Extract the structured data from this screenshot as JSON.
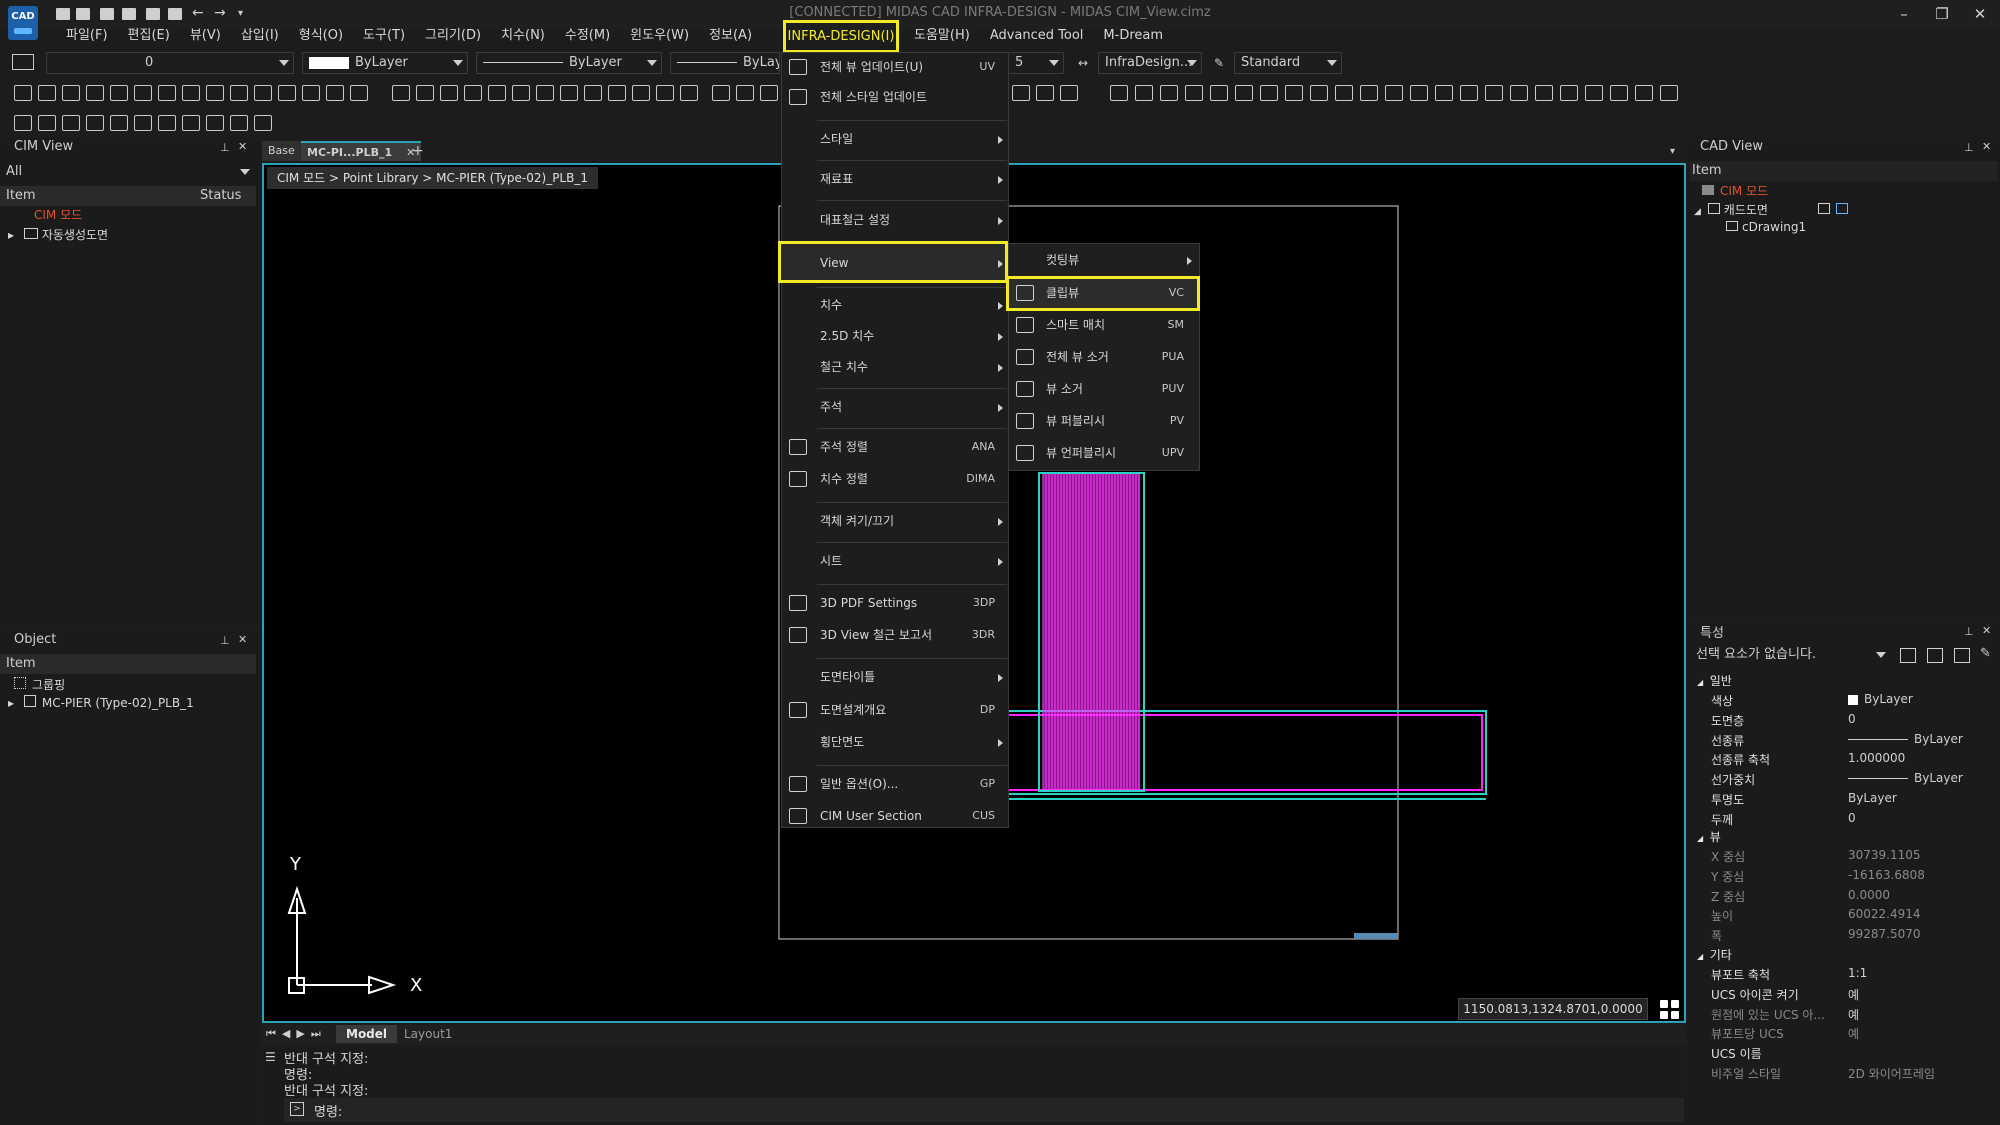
{
  "app": {
    "title": "[CONNECTED] MIDAS CAD INFRA-DESIGN - MIDAS CIM_View.cimz",
    "logo_text": "CAD",
    "accent": "#f2ea25",
    "viewport_border": "#2aa3b8"
  },
  "menubar": [
    "파일(F)",
    "편집(E)",
    "뷰(V)",
    "삽입(I)",
    "형식(O)",
    "도구(T)",
    "그리기(D)",
    "치수(N)",
    "수정(M)",
    "윈도우(W)",
    "정보(A)"
  ],
  "menubar_active": "INFRA-DESIGN(I)",
  "menubar_after": [
    "도움말(H)",
    "Advanced Tool",
    "M-Dream"
  ],
  "toolbar": {
    "layer_value": "0",
    "color_value": "ByLayer",
    "linetype_value": "ByLayer",
    "lineweight_value": "ByLay",
    "scale_value": "5",
    "dimstyle_value": "InfraDesign...",
    "textstyle_value": "Standard"
  },
  "cim_view": {
    "title": "CIM View",
    "filter": "All",
    "col_item": "Item",
    "col_status": "Status",
    "items": [
      "CIM 모드",
      "자동생성도면"
    ]
  },
  "object_panel": {
    "title": "Object",
    "col_item": "Item",
    "items": [
      "그룹핑",
      "MC-PIER (Type-02)_PLB_1"
    ]
  },
  "doc_tabs": [
    "Base",
    "MC-PI...PLB_1"
  ],
  "breadcrumb": "CIM 모드 > Point Library > MC-PIER (Type-02)_PLB_1",
  "main_menu": [
    {
      "label": "전체 뷰 업데이트(U)",
      "key": "UV"
    },
    {
      "label": "전체 스타일 업데이트",
      "key": ""
    },
    {
      "label": "스타일",
      "key": ""
    },
    {
      "label": "재료표",
      "key": ""
    },
    {
      "label": "대표철근 설정",
      "key": ""
    },
    {
      "label": "View",
      "key": ""
    },
    {
      "label": "치수",
      "key": ""
    },
    {
      "label": "2.5D 치수",
      "key": ""
    },
    {
      "label": "철근 치수",
      "key": ""
    },
    {
      "label": "주석",
      "key": ""
    },
    {
      "label": "주석 정렬",
      "key": "ANA"
    },
    {
      "label": "치수 정렬",
      "key": "DIMA"
    },
    {
      "label": "객체 켜기/끄기",
      "key": ""
    },
    {
      "label": "시트",
      "key": ""
    },
    {
      "label": "3D PDF Settings",
      "key": "3DP"
    },
    {
      "label": "3D View 철근 보고서",
      "key": "3DR"
    },
    {
      "label": "도면타이틀",
      "key": ""
    },
    {
      "label": "도면설계개요",
      "key": "DP"
    },
    {
      "label": "횡단면도",
      "key": ""
    },
    {
      "label": "일반 옵션(O)...",
      "key": "GP"
    },
    {
      "label": "CIM User Section",
      "key": "CUS"
    }
  ],
  "sub_menu": [
    {
      "label": "컷팅뷰",
      "key": ""
    },
    {
      "label": "클립뷰",
      "key": "VC"
    },
    {
      "label": "스마트 매치",
      "key": "SM"
    },
    {
      "label": "전체 뷰 소거",
      "key": "PUA"
    },
    {
      "label": "뷰 소거",
      "key": "PUV"
    },
    {
      "label": "뷰 퍼블리시",
      "key": "PV"
    },
    {
      "label": "뷰 언퍼블리시",
      "key": "UPV"
    }
  ],
  "viewport": {
    "axis_y": "Y",
    "axis_x": "X",
    "coords": "1150.0813,1324.8701,0.0000",
    "layout_tabs": [
      "Model",
      "Layout1"
    ]
  },
  "command_line": [
    "반대 구석 지정:",
    "명령:",
    "반대 구석 지정:",
    "명령:"
  ],
  "cad_view": {
    "title": "CAD View",
    "col_item": "Item",
    "items": [
      "CIM 모드",
      "캐드도면",
      "cDrawing1"
    ]
  },
  "properties": {
    "title": "특성",
    "selection": "선택 요소가 없습니다.",
    "group_general": "일반",
    "general": [
      {
        "k": "색상",
        "v": "ByLayer"
      },
      {
        "k": "도면층",
        "v": "0"
      },
      {
        "k": "선종류",
        "v": "ByLayer"
      },
      {
        "k": "선종류 축척",
        "v": "1.000000"
      },
      {
        "k": "선가중치",
        "v": "ByLayer"
      },
      {
        "k": "투명도",
        "v": "ByLayer"
      },
      {
        "k": "두께",
        "v": "0"
      }
    ],
    "group_view": "뷰",
    "view": [
      {
        "k": "X 중심",
        "v": "30739.1105"
      },
      {
        "k": "Y 중심",
        "v": "-16163.6808"
      },
      {
        "k": "Z 중심",
        "v": "0.0000"
      },
      {
        "k": "높이",
        "v": "60022.4914"
      },
      {
        "k": "폭",
        "v": "99287.5070"
      }
    ],
    "group_misc": "기타",
    "misc": [
      {
        "k": "뷰포트 축척",
        "v": "1:1"
      },
      {
        "k": "UCS 아이콘 켜기",
        "v": "예"
      },
      {
        "k": "원점에 있는 UCS 아...",
        "v": "예"
      },
      {
        "k": "뷰포트당 UCS",
        "v": "예"
      },
      {
        "k": "UCS 이름",
        "v": ""
      },
      {
        "k": "비주얼 스타일",
        "v": "2D 와이어프레임"
      }
    ]
  }
}
